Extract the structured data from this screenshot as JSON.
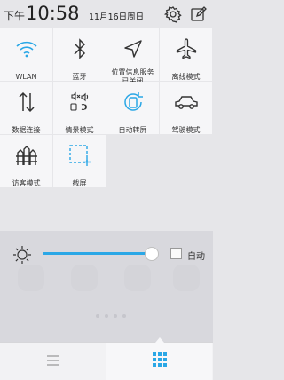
{
  "status_bar": {
    "time_prefix": "下午",
    "time": "10:58",
    "date": "11月16日周日",
    "icons": [
      "settings-icon",
      "edit-icon"
    ]
  },
  "tiles": [
    {
      "label": "WLAN",
      "icon": "wifi-icon",
      "active": true
    },
    {
      "label": "蓝牙",
      "icon": "bluetooth-icon",
      "active": false
    },
    {
      "label": "位置信息服务已关闭",
      "icon": "location-icon",
      "active": false
    },
    {
      "label": "离线模式",
      "icon": "airplane-icon",
      "active": false
    },
    {
      "label": "数据连接",
      "icon": "data-arrows-icon",
      "active": false
    },
    {
      "label": "情景模式",
      "icon": "sound-profile-icon",
      "active": false
    },
    {
      "label": "自动转屏",
      "icon": "auto-rotate-icon",
      "active": true
    },
    {
      "label": "驾驶模式",
      "icon": "car-icon",
      "active": false
    },
    {
      "label": "访客模式",
      "icon": "guest-mode-icon",
      "active": false
    },
    {
      "label": "截屏",
      "icon": "screenshot-icon",
      "active": false
    }
  ],
  "brightness": {
    "level": 0.88,
    "auto_label": "自动",
    "auto_checked": false
  },
  "bottom_tabs": [
    {
      "icon": "list-icon",
      "active": false
    },
    {
      "icon": "grid-icon",
      "active": true
    }
  ],
  "colors": {
    "accent": "#2aa7e6",
    "tile_bg": "#f6f6f8",
    "panel_bg": "#e6e6e9"
  }
}
